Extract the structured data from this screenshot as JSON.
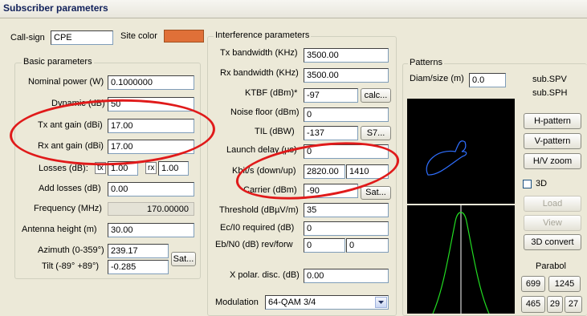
{
  "title": "Subscriber parameters",
  "top": {
    "callsign_label": "Call-sign",
    "callsign_value": "CPE",
    "site_color_label": "Site color",
    "site_color": "#e07038"
  },
  "basic": {
    "group_title": "Basic parameters",
    "nominal_power_label": "Nominal power (W)",
    "nominal_power_value": "0.1000000",
    "dynamic_label": "Dynamic (dB)",
    "dynamic_value": "50",
    "tx_gain_label": "Tx ant gain (dBi)",
    "tx_gain_value": "17.00",
    "rx_gain_label": "Rx ant gain (dBi)",
    "rx_gain_value": "17.00",
    "losses_label": "Losses (dB):",
    "tx_tag": "tx",
    "losses_tx_value": "1.00",
    "rx_tag": "rx",
    "losses_rx_value": "1.00",
    "add_losses_label": "Add losses (dB)",
    "add_losses_value": "0.00",
    "frequency_label": "Frequency (MHz)",
    "frequency_value": "170.00000",
    "antenna_height_label": "Antenna height (m)",
    "antenna_height_value": "30.00",
    "azimuth_label": "Azimuth (0-359°)",
    "azimuth_value": "239.17",
    "tilt_label": "Tilt (-89° +89°)",
    "tilt_value": "-0.285",
    "sat_button": "Sat..."
  },
  "interference": {
    "group_title": "Interference parameters",
    "tx_bw_label": "Tx bandwidth (KHz)",
    "tx_bw_value": "3500.00",
    "rx_bw_label": "Rx bandwidth (KHz)",
    "rx_bw_value": "3500.00",
    "ktbf_label": "KTBF (dBm)*",
    "ktbf_value": "-97",
    "calc_button": "calc...",
    "noise_label": "Noise floor (dBm)",
    "noise_value": "0",
    "til_label": "TIL (dBW)",
    "til_value": "-137",
    "s7_button": "S7...",
    "launch_label": "Launch delay (µs)",
    "launch_value": "0",
    "kbits_label": "Kbit/s (down/up)",
    "kbits_down": "2820.00",
    "kbits_up": "1410",
    "carrier_label": "Carrier (dBm)",
    "carrier_value": "-90",
    "sat_button": "Sat...",
    "threshold_label": "Threshold (dBµV/m)",
    "threshold_value": "35",
    "ec_label": "Ec/I0 required (dB)",
    "ec_value": "0",
    "eb_label": "Eb/N0 (dB) rev/forw",
    "eb_rev": "0",
    "eb_forw": "0",
    "xpol_label": "X polar. disc. (dB)",
    "xpol_value": "0.00",
    "modulation_label": "Modulation",
    "modulation_value": "64-QAM 3/4"
  },
  "patterns": {
    "group_title": "Patterns",
    "diam_label": "Diam/size (m)",
    "diam_value": "0.0",
    "file_v": "sub.SPV",
    "file_h": "sub.SPH",
    "h_pattern": "H-pattern",
    "v_pattern": "V-pattern",
    "hv_zoom": "H/V zoom",
    "three_d_label": "3D",
    "load": "Load",
    "view": "View",
    "convert": "3D convert",
    "parabol_label": "Parabol",
    "parabol_row1": [
      "699",
      "1245"
    ],
    "parabol_row2": [
      "465",
      "29",
      "27"
    ]
  }
}
